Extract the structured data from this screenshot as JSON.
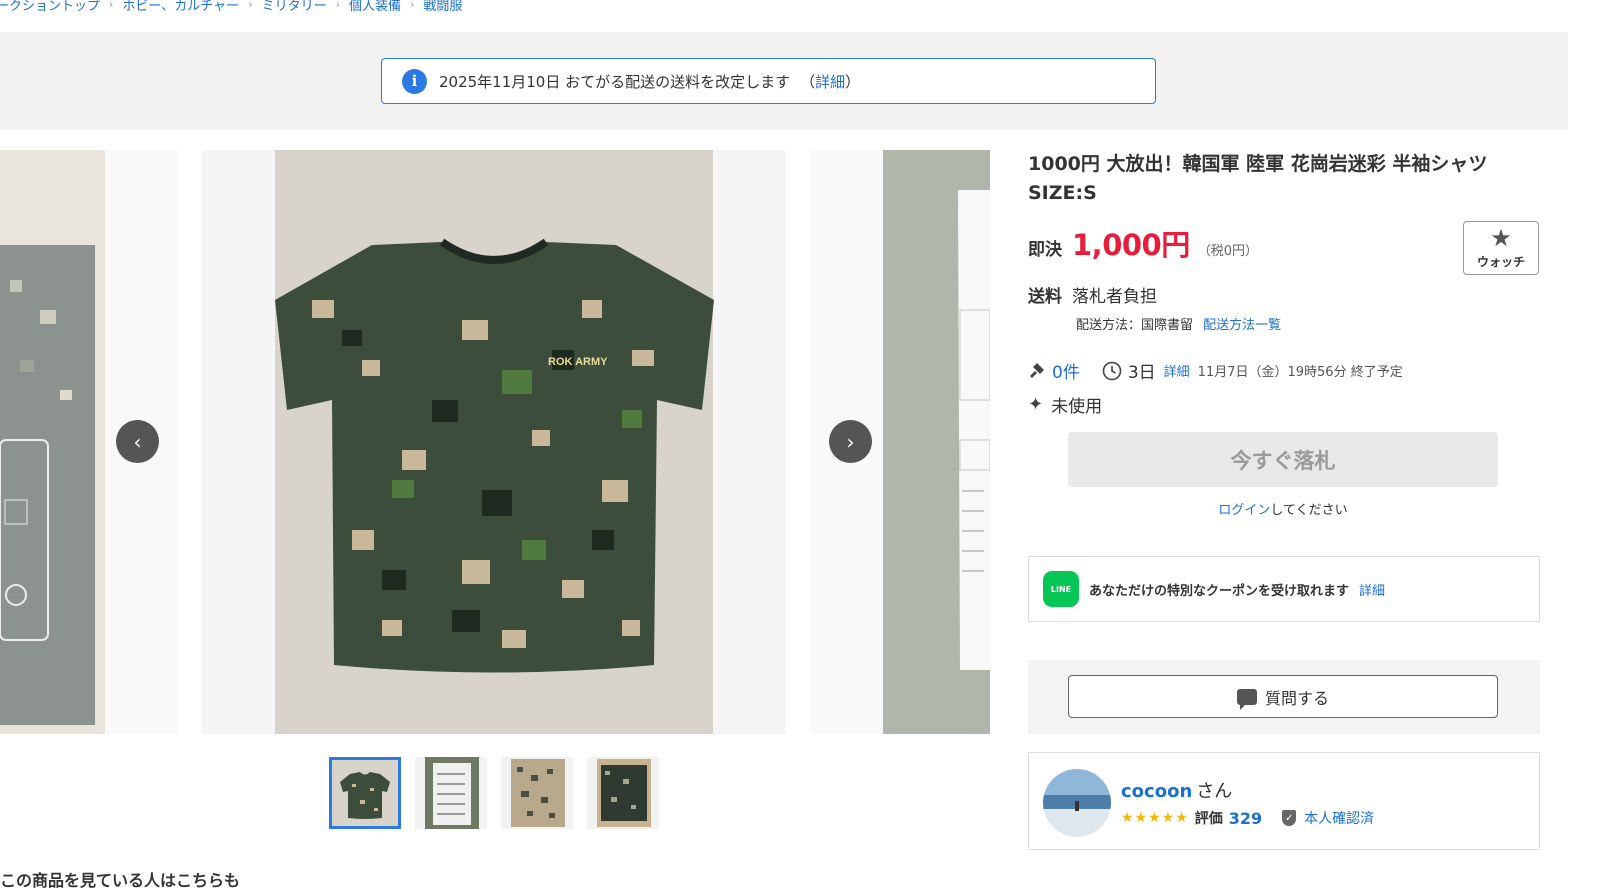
{
  "breadcrumb": {
    "items": [
      "ークショントップ",
      "ホビー、カルチャー",
      "ミリタリー",
      "個人装備",
      "戦闘服"
    ]
  },
  "notice": {
    "text": "2025年11月10日 おてがる配送の送料を改定します",
    "open_paren": "（",
    "link": "詳細",
    "close_paren": "）",
    "icon": "info-icon"
  },
  "gallery": {
    "prev_icon": "chevron-left-icon",
    "next_icon": "chevron-right-icon",
    "main_image_text": "ROK ARMY",
    "thumbnail_count": 4,
    "active_thumbnail": 1
  },
  "bottom_heading": "この商品を見ている人はこちらも",
  "item": {
    "title": "1000円 大放出！韓国軍 陸軍 花崗岩迷彩 半袖シャツ SIZE:S",
    "price_label": "即決",
    "price": "1,000円",
    "tax": "（税0円）",
    "watch_label": "ウォッチ",
    "shipping_label": "送料",
    "shipping_value": "落札者負担",
    "shipping_method": "配送方法：国際書留",
    "shipping_link": "配送方法一覧",
    "bids": "0件",
    "remaining": "3日",
    "detail_link": "詳細",
    "end_time": "11月7日（金）19時56分 終了予定",
    "condition": "未使用",
    "buy_now": "今すぐ落札",
    "login_link": "ログイン",
    "login_suffix": "してください"
  },
  "line_promo": {
    "icon_text": "LINE",
    "text": "あなただけの特別なクーポンを受け取れます",
    "link": "詳細"
  },
  "question_button": "質問する",
  "seller": {
    "name": "cocoon",
    "suffix": "さん",
    "stars": "★★★★★",
    "rating_label": "評価",
    "rating": "329",
    "verified": "本人確認済"
  },
  "colors": {
    "link": "#1a6fd1",
    "price": "#e61e3c",
    "accent": "#2a7ae2",
    "line_green": "#06c755",
    "star": "#f5b800"
  }
}
